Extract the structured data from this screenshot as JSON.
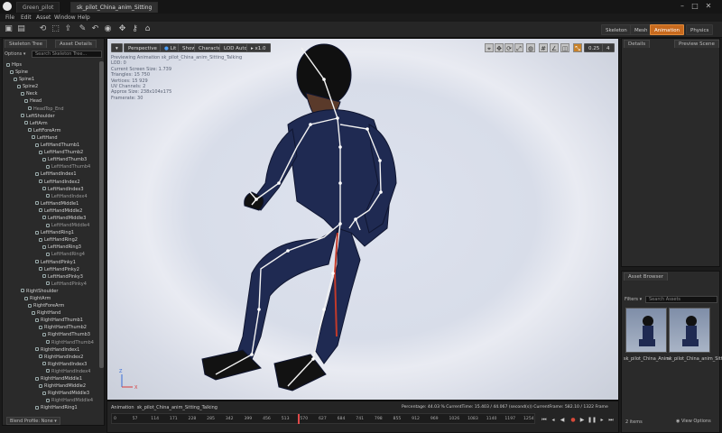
{
  "titlebar": {
    "tabs": [
      "Green_pilot",
      "sk_pilot_China_anim_Sitting"
    ],
    "window_controls": {
      "min": "–",
      "max": "□",
      "close": "✕"
    }
  },
  "menubar": {
    "items": [
      "File",
      "Edit",
      "Asset",
      "Window",
      "Help"
    ]
  },
  "toolbar": {
    "modes": [
      "Skeleton",
      "Mesh",
      "Animation",
      "Physics"
    ],
    "active_mode": "Animation"
  },
  "skeleton_panel": {
    "tabs": [
      "Skeleton Tree",
      "Asset Details"
    ],
    "options_label": "Options",
    "search_placeholder": "Search Skeleton Tree...",
    "bones": [
      {
        "name": "Hips",
        "depth": 0
      },
      {
        "name": "Spine",
        "depth": 1
      },
      {
        "name": "Spine1",
        "depth": 2
      },
      {
        "name": "Spine2",
        "depth": 3
      },
      {
        "name": "Neck",
        "depth": 4
      },
      {
        "name": "Head",
        "depth": 5
      },
      {
        "name": "HeadTop_End",
        "depth": 6,
        "leaf": true
      },
      {
        "name": "LeftShoulder",
        "depth": 4
      },
      {
        "name": "LeftArm",
        "depth": 5
      },
      {
        "name": "LeftForeArm",
        "depth": 6
      },
      {
        "name": "LeftHand",
        "depth": 7
      },
      {
        "name": "LeftHandThumb1",
        "depth": 8
      },
      {
        "name": "LeftHandThumb2",
        "depth": 9
      },
      {
        "name": "LeftHandThumb3",
        "depth": 10
      },
      {
        "name": "LeftHandThumb4",
        "depth": 11,
        "leaf": true
      },
      {
        "name": "LeftHandIndex1",
        "depth": 8
      },
      {
        "name": "LeftHandIndex2",
        "depth": 9
      },
      {
        "name": "LeftHandIndex3",
        "depth": 10
      },
      {
        "name": "LeftHandIndex4",
        "depth": 11,
        "leaf": true
      },
      {
        "name": "LeftHandMiddle1",
        "depth": 8
      },
      {
        "name": "LeftHandMiddle2",
        "depth": 9
      },
      {
        "name": "LeftHandMiddle3",
        "depth": 10
      },
      {
        "name": "LeftHandMiddle4",
        "depth": 11,
        "leaf": true
      },
      {
        "name": "LeftHandRing1",
        "depth": 8
      },
      {
        "name": "LeftHandRing2",
        "depth": 9
      },
      {
        "name": "LeftHandRing3",
        "depth": 10
      },
      {
        "name": "LeftHandRing4",
        "depth": 11,
        "leaf": true
      },
      {
        "name": "LeftHandPinky1",
        "depth": 8
      },
      {
        "name": "LeftHandPinky2",
        "depth": 9
      },
      {
        "name": "LeftHandPinky3",
        "depth": 10
      },
      {
        "name": "LeftHandPinky4",
        "depth": 11,
        "leaf": true
      },
      {
        "name": "RightShoulder",
        "depth": 4
      },
      {
        "name": "RightArm",
        "depth": 5
      },
      {
        "name": "RightForeArm",
        "depth": 6
      },
      {
        "name": "RightHand",
        "depth": 7
      },
      {
        "name": "RightHandThumb1",
        "depth": 8
      },
      {
        "name": "RightHandThumb2",
        "depth": 9
      },
      {
        "name": "RightHandThumb3",
        "depth": 10
      },
      {
        "name": "RightHandThumb4",
        "depth": 11,
        "leaf": true
      },
      {
        "name": "RightHandIndex1",
        "depth": 8
      },
      {
        "name": "RightHandIndex2",
        "depth": 9
      },
      {
        "name": "RightHandIndex3",
        "depth": 10
      },
      {
        "name": "RightHandIndex4",
        "depth": 11,
        "leaf": true
      },
      {
        "name": "RightHandMiddle1",
        "depth": 8
      },
      {
        "name": "RightHandMiddle2",
        "depth": 9
      },
      {
        "name": "RightHandMiddle3",
        "depth": 10
      },
      {
        "name": "RightHandMiddle4",
        "depth": 11,
        "leaf": true
      },
      {
        "name": "RightHandRing1",
        "depth": 8
      }
    ],
    "footer_filter": "Blend Profile: None"
  },
  "viewport": {
    "buttons": [
      "Perspective",
      "Lit",
      "Show",
      "Character",
      "LOD Auto",
      "x1.0"
    ],
    "right_values": [
      "0.25",
      "4"
    ],
    "stats": [
      "Previewing Animation sk_pilot_China_anim_Sitting_Talking",
      "LOD: 0",
      "Current Screen Size: 1.739",
      "Triangles: 15 750",
      "Vertices: 15 929",
      "UV Channels: 2",
      "Approx Size: 238x104x175",
      "Framerate: 30"
    ],
    "axis_labels": {
      "z": "Z",
      "x": "X"
    }
  },
  "timeline": {
    "track_name": "Animation",
    "anim_name": "sk_pilot_China_anim_Sitting_Talking",
    "status": "Percentage: 44.03 %  CurrentTime: 15.403 / 44.067 (second(s))  CurrentFrame: 582.10 / 1322 Frame",
    "ticks": [
      "0",
      "57",
      "114",
      "171",
      "228",
      "285",
      "342",
      "399",
      "456",
      "513",
      "570",
      "627",
      "684",
      "741",
      "798",
      "855",
      "912",
      "969",
      "1026",
      "1083",
      "1140",
      "1197",
      "1254"
    ],
    "progress": 0.4403
  },
  "details_panel": {
    "tabs": [
      "Details",
      "Preview Scene"
    ]
  },
  "asset_browser": {
    "tab": "Asset Browser",
    "filters_label": "Filters",
    "search_placeholder": "Search Assets",
    "assets": [
      "sk_pilot_China_Anim",
      "sk_pilot_China_anim_Sitting_Talking"
    ],
    "count": "2 items",
    "view_options": "View Options"
  }
}
